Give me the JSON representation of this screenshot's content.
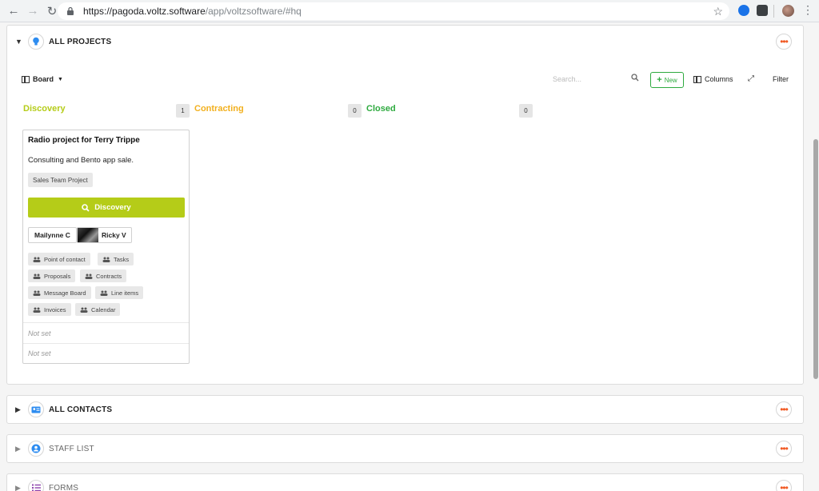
{
  "browser": {
    "url_host": "https://pagoda.voltz.software",
    "url_path": "/app/voltzsoftware/#hq"
  },
  "projects": {
    "title": "ALL PROJECTS",
    "toolbar": {
      "view_label": "Board",
      "search_placeholder": "Search...",
      "new_label": "New",
      "columns_label": "Columns",
      "filter_label": "Filter"
    },
    "columns": [
      {
        "title": "Discovery",
        "count": "1",
        "color": "#b5cc18"
      },
      {
        "title": "Contracting",
        "count": "0",
        "color": "#f2b01e"
      },
      {
        "title": "Closed",
        "count": "0",
        "color": "#2eaa3f"
      }
    ],
    "card": {
      "title": "Radio project for Terry Trippe",
      "description": "Consulting and Bento app sale.",
      "tag": "Sales Team Project",
      "stage": "Discovery",
      "people": [
        "Mailynne C",
        "Ricky V"
      ],
      "chips": [
        "Point of contact",
        "Tasks",
        "Proposals",
        "Contracts",
        "Message Board",
        "Line items",
        "Invoices",
        "Calendar"
      ],
      "not_set_1": "Not set",
      "not_set_2": "Not set"
    }
  },
  "contacts": {
    "title": "ALL CONTACTS"
  },
  "staff": {
    "title": "STAFF LIST"
  },
  "forms": {
    "title": "FORMS"
  },
  "colors": {
    "accent_orange": "#f15a24",
    "discovery": "#b5cc18",
    "contracting": "#f2b01e",
    "closed": "#2eaa3f"
  }
}
